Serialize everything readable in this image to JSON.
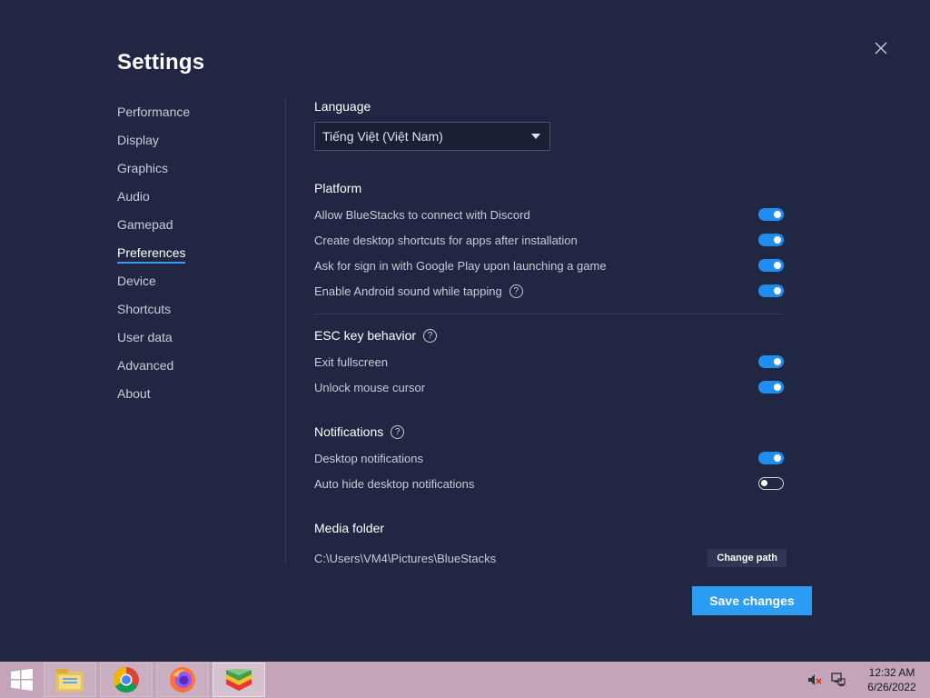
{
  "window": {
    "title": "Settings"
  },
  "sidebar": {
    "items": [
      {
        "label": "Performance"
      },
      {
        "label": "Display"
      },
      {
        "label": "Graphics"
      },
      {
        "label": "Audio"
      },
      {
        "label": "Gamepad"
      },
      {
        "label": "Preferences",
        "active": true
      },
      {
        "label": "Device"
      },
      {
        "label": "Shortcuts"
      },
      {
        "label": "User data"
      },
      {
        "label": "Advanced"
      },
      {
        "label": "About"
      }
    ]
  },
  "language": {
    "title": "Language",
    "selected": "Tiếng Việt (Việt Nam)"
  },
  "platform": {
    "title": "Platform",
    "options": [
      {
        "label": "Allow BlueStacks to connect with Discord",
        "enabled": true
      },
      {
        "label": "Create desktop shortcuts for apps after installation",
        "enabled": true
      },
      {
        "label": "Ask for sign in with Google Play upon launching a game",
        "enabled": true
      },
      {
        "label": "Enable Android sound while tapping",
        "enabled": true,
        "help": true
      }
    ]
  },
  "esc": {
    "title": "ESC key behavior",
    "options": [
      {
        "label": "Exit fullscreen",
        "enabled": true
      },
      {
        "label": "Unlock mouse cursor",
        "enabled": true
      }
    ]
  },
  "notifications": {
    "title": "Notifications",
    "options": [
      {
        "label": "Desktop notifications",
        "enabled": true
      },
      {
        "label": "Auto hide desktop notifications",
        "enabled": false
      }
    ]
  },
  "media": {
    "title": "Media folder",
    "path": "C:\\Users\\VM4\\Pictures\\BlueStacks",
    "change_label": "Change path"
  },
  "footer": {
    "save_label": "Save changes"
  },
  "help_glyph": "?",
  "taskbar": {
    "apps": [
      {
        "icon": "file-explorer-icon"
      },
      {
        "icon": "chrome-icon"
      },
      {
        "icon": "firefox-icon"
      },
      {
        "icon": "bluestacks-icon",
        "active": true
      }
    ],
    "time": "12:32 AM",
    "date": "6/26/2022"
  },
  "colors": {
    "background": "#212742",
    "accent": "#2b9df5",
    "toggle_on": "#1f8ef1"
  }
}
